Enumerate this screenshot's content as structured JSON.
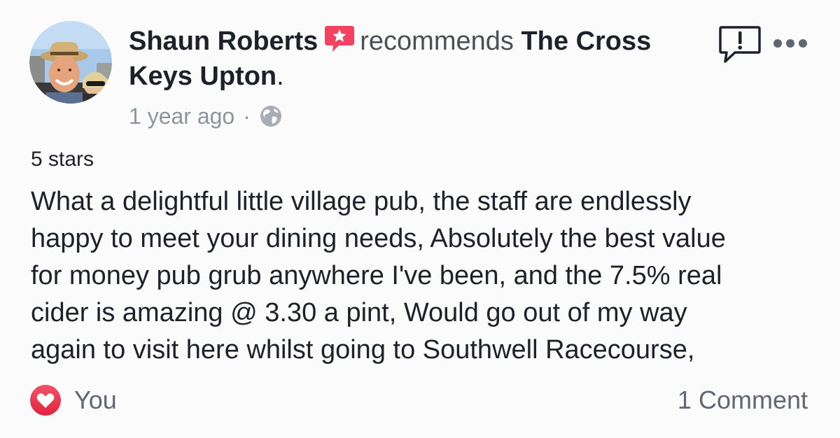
{
  "post": {
    "author": "Shaun Roberts",
    "verb": "recommends",
    "place": "The Cross Keys Upton",
    "place_suffix": ".",
    "timestamp": "1 year ago",
    "separator": "·",
    "privacy_icon": "globe-icon",
    "rating_text": "5 stars",
    "body_lines": [
      "What a delightful little village pub, the staff are endlessly",
      "happy to meet your dining needs, Absolutely the best value",
      "for money pub grub anywhere I've been, and the 7.5% real",
      "cider is amazing @ 3.30 a pint, Would go out of my way",
      "again to visit here whilst going to Southwell Racecourse,"
    ]
  },
  "icons": {
    "recommend": "recommend-badge-icon",
    "report": "report-icon",
    "more": "more-options-icon",
    "reaction": "heart-icon"
  },
  "footer": {
    "reactions_label": "You",
    "comments_label": "1 Comment"
  },
  "colors": {
    "text_primary": "#1d2129",
    "text_secondary": "#8d949e",
    "recommend_badge": "#f3425f",
    "heart": "#e8354d"
  }
}
